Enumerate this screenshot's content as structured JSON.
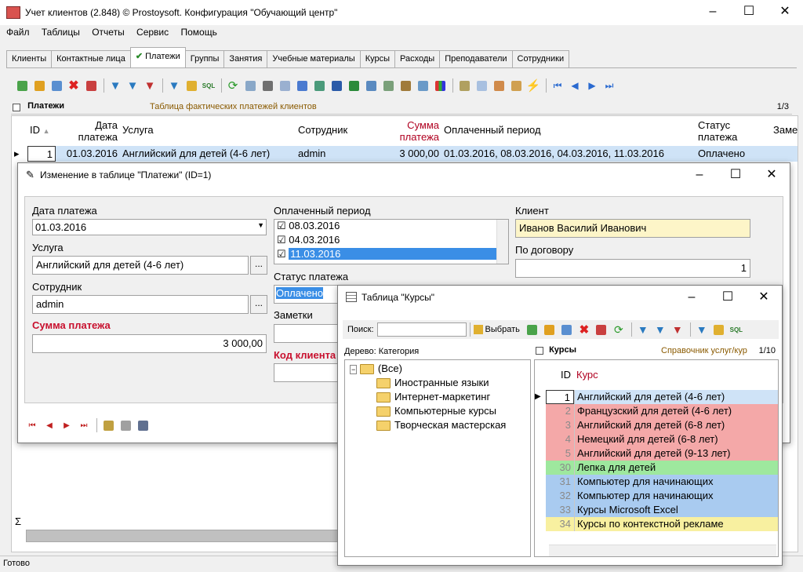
{
  "app": {
    "title": "Учет клиентов (2.848) © Prostoysoft. Конфигурация \"Обучающий центр\"",
    "status": "Готово"
  },
  "menu": [
    "Файл",
    "Таблицы",
    "Отчеты",
    "Сервис",
    "Помощь"
  ],
  "tabs": [
    "Клиенты",
    "Контактные лица",
    "Платежи",
    "Группы",
    "Занятия",
    "Учебные материалы",
    "Курсы",
    "Расходы",
    "Преподаватели",
    "Сотрудники"
  ],
  "active_tab": "Платежи",
  "panel": {
    "title": "Платежи",
    "subtitle": "Таблица фактических платежей клиентов",
    "pager": "1/3"
  },
  "grid": {
    "columns": [
      "ID",
      "Дата платежа",
      "Услуга",
      "Сотрудник",
      "Сумма платежа",
      "Оплаченный период",
      "Статус платежа",
      "Замет"
    ],
    "row": {
      "id": "1",
      "date": "01.03.2016",
      "service": "Английский для детей (4-6 лет)",
      "employee": "admin",
      "sum": "3 000,00",
      "period": "01.03.2016, 08.03.2016, 04.03.2016, 11.03.2016",
      "status": "Оплачено"
    },
    "footer_sigma": "Σ"
  },
  "edit_dialog": {
    "title": "Изменение в таблице \"Платежи\" (ID=1)",
    "date_label": "Дата платежа",
    "date_value": "01.03.2016",
    "service_label": "Услуга",
    "service_value": "Английский для детей (4-6 лет)",
    "employee_label": "Сотрудник",
    "employee_value": "admin",
    "sum_label": "Сумма платежа",
    "sum_value": "3 000,00",
    "period_label": "Оплаченный период",
    "periods": [
      {
        "date": "08.03.2016",
        "checked": true
      },
      {
        "date": "04.03.2016",
        "checked": true
      },
      {
        "date": "11.03.2016",
        "checked": true
      }
    ],
    "status_label": "Статус платежа",
    "status_value": "Оплачено",
    "notes_label": "Заметки",
    "client_code_label": "Код клиента",
    "client_label": "Клиент",
    "client_value": "Иванов Василий Иванович",
    "contract_label": "По договору",
    "contract_value": "1",
    "dots": "..."
  },
  "courses_dialog": {
    "title": "Таблица \"Курсы\"",
    "search_label": "Поиск:",
    "select_label": "Выбрать",
    "tree_header": "Дерево: Категория",
    "tree": [
      "(Все)",
      "Иностранные языки",
      "Интернет-маркетинг",
      "Компьютерные курсы",
      "Творческая мастерская"
    ],
    "panel_title": "Курсы",
    "panel_subtitle": "Справочник услуг/кур",
    "pager": "1/10",
    "col_id": "ID",
    "col_name": "Курс",
    "rows": [
      {
        "id": "1",
        "name": "Английский для детей (4-6 лет)",
        "color": "#cfe3f7"
      },
      {
        "id": "2",
        "name": "Французский для детей (4-6 лет)",
        "color": "#f4a8a8"
      },
      {
        "id": "3",
        "name": "Английский для детей (6-8 лет)",
        "color": "#f4a8a8"
      },
      {
        "id": "4",
        "name": "Немецкий для детей (6-8 лет)",
        "color": "#f4a8a8"
      },
      {
        "id": "5",
        "name": "Английский для детей (9-13 лет)",
        "color": "#f4a8a8"
      },
      {
        "id": "30",
        "name": "Лепка для детей",
        "color": "#9ee89e"
      },
      {
        "id": "31",
        "name": "Компьютер для начинающих",
        "color": "#a9cbf0"
      },
      {
        "id": "32",
        "name": "Компьютер для начинающих",
        "color": "#a9cbf0"
      },
      {
        "id": "33",
        "name": "Курсы Microsoft Excel",
        "color": "#a9cbf0"
      },
      {
        "id": "34",
        "name": "Курсы по контекстной рекламе",
        "color": "#f8f0a0"
      }
    ]
  }
}
